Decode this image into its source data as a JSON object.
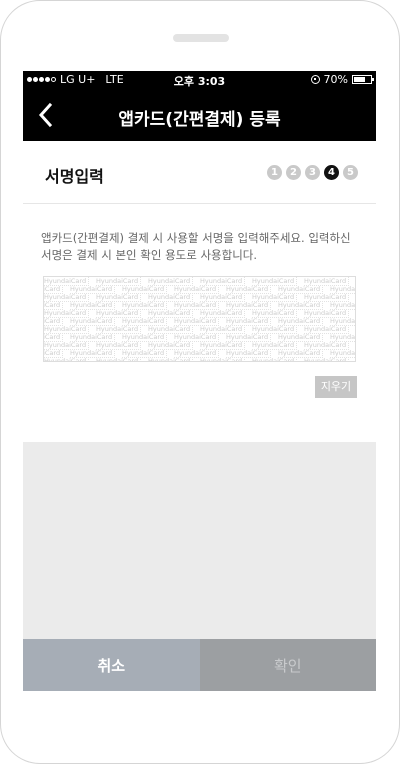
{
  "status_bar": {
    "carrier": "LG U+",
    "network": "LTE",
    "time": "오후 3:03",
    "battery": "70%",
    "battery_level": 0.7
  },
  "header": {
    "title": "앱카드(간편결제) 등록"
  },
  "step": {
    "title": "서명입력",
    "steps": [
      "1",
      "2",
      "3",
      "4",
      "5"
    ],
    "current": 4
  },
  "instruction": "앱카드(간편결제) 결제 시 사용할 서명을 입력해주세요. 입력하신 서명은 결제 시 본인 확인 용도로 사용합니다.",
  "signature_pad": {
    "watermark": "HyundaiCard"
  },
  "clear_label": "지우기",
  "footer": {
    "cancel_label": "취소",
    "confirm_label": "확인"
  },
  "colors": {
    "title_bar": "#000000",
    "step_active": "#111111",
    "step_inactive": "#c9c9c9",
    "cancel_button": "#a6adb6",
    "confirm_button": "#9c9fa2"
  },
  "icons": {
    "back": "chevron-left-icon",
    "rotation_lock": "rotation-lock-icon",
    "battery": "battery-icon"
  }
}
